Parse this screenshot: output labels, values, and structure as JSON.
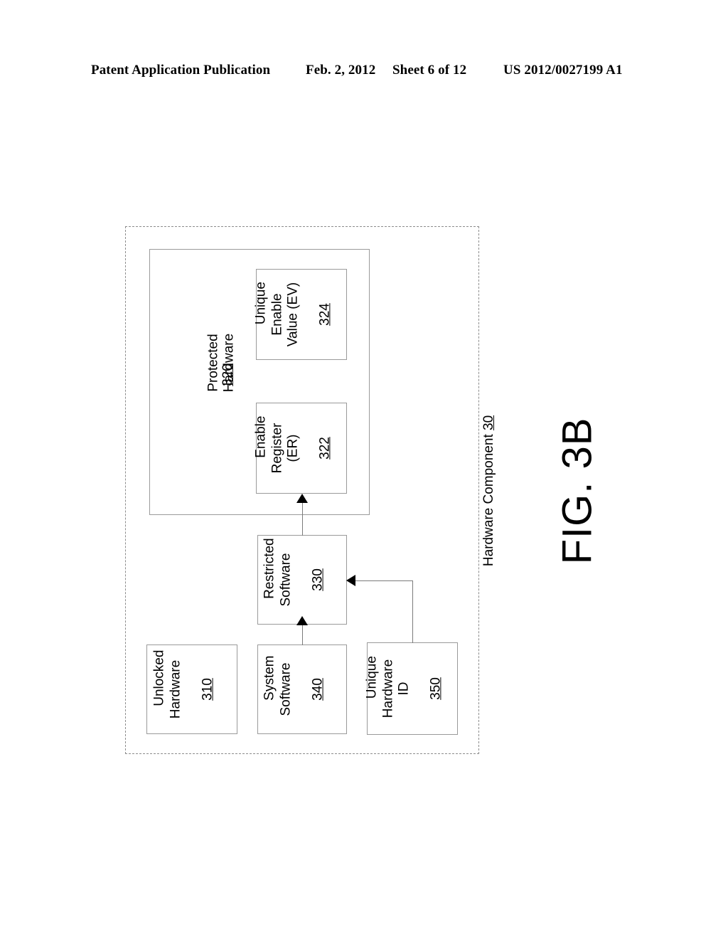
{
  "header": {
    "publication": "Patent Application Publication",
    "date": "Feb. 2, 2012",
    "sheet": "Sheet 6 of 12",
    "publication_number": "US 2012/0027199 A1"
  },
  "figure": {
    "label": "FIG. 3B",
    "container": {
      "name": "Hardware Component",
      "ref": "30",
      "label_full": "Hardware Component 30"
    },
    "protected_hardware": {
      "name": "Protected\nHardware",
      "ref": "320"
    },
    "boxes": {
      "unique_enable_value": {
        "name": "Unique\nEnable\nValue (EV)",
        "ref": "324"
      },
      "enable_register": {
        "name": "Enable\nRegister\n(ER)",
        "ref": "322"
      },
      "restricted_software": {
        "name": "Restricted\nSoftware",
        "ref": "330"
      },
      "unlocked_hardware": {
        "name": "Unlocked\nHardware",
        "ref": "310"
      },
      "system_software": {
        "name": "System\nSoftware",
        "ref": "340"
      },
      "unique_hardware_id": {
        "name": "Unique\nHardware\nID",
        "ref": "350"
      }
    },
    "connectors": [
      {
        "from": "restricted_software",
        "to": "enable_register",
        "style": "arrow"
      },
      {
        "from": "system_software",
        "to": "restricted_software",
        "style": "arrow"
      },
      {
        "from": "unique_hardware_id",
        "to": "restricted_software",
        "style": "arrow"
      }
    ]
  },
  "colors": {
    "ink": "#000000",
    "line": "#8c8c8c",
    "background": "#ffffff"
  }
}
